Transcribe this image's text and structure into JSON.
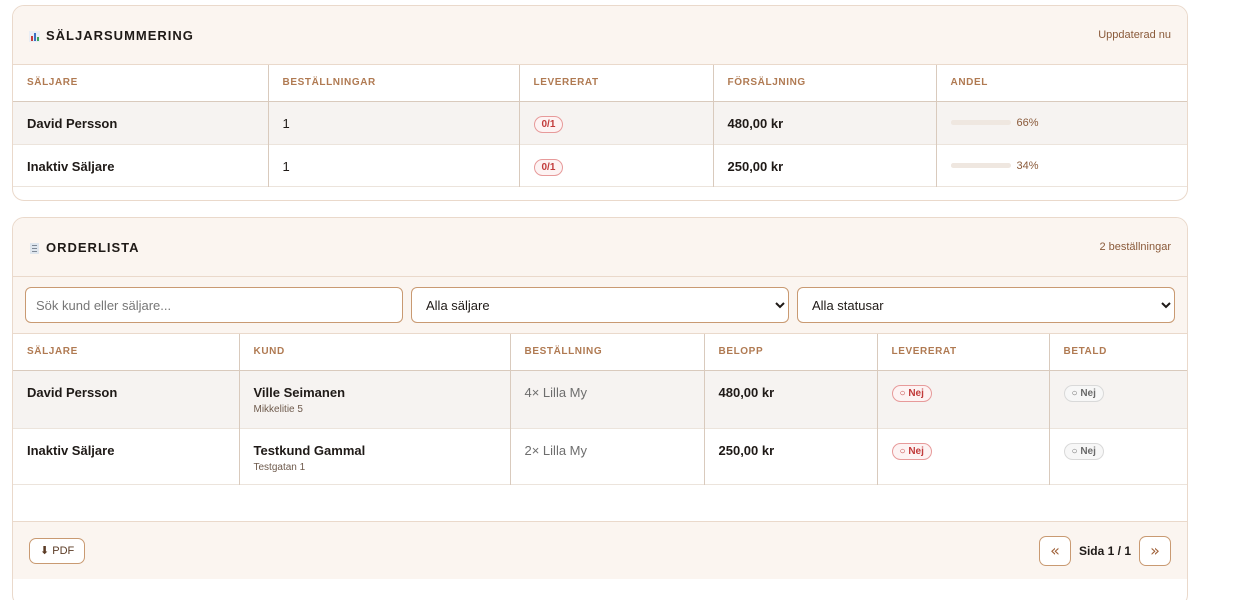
{
  "summary": {
    "title": "SÄLJARSUMMERING",
    "updated": "Uppdaterad nu",
    "columns": [
      "SÄLJARE",
      "BESTÄLLNINGAR",
      "LEVERERAT",
      "FÖRSÄLJNING",
      "ANDEL"
    ],
    "rows": [
      {
        "seller": "David Persson",
        "orders": "1",
        "delivered": "0/1",
        "sales": "480,00 kr",
        "share": "66%",
        "share_value": 66
      },
      {
        "seller": "Inaktiv Säljare",
        "orders": "1",
        "delivered": "0/1",
        "sales": "250,00 kr",
        "share": "34%",
        "share_value": 34
      }
    ]
  },
  "orders": {
    "title": "ORDERLISTA",
    "count": "2 beställningar",
    "search_placeholder": "Sök kund eller säljare...",
    "seller_filter": "Alla säljare",
    "status_filter": "Alla statusar",
    "columns": [
      "SÄLJARE",
      "KUND",
      "BESTÄLLNING",
      "BELOPP",
      "LEVERERAT",
      "BETALD"
    ],
    "rows": [
      {
        "seller": "David Persson",
        "customer": "Ville Seimanen",
        "address": "Mikkelitie 5",
        "order": "4× Lilla My",
        "amount": "480,00 kr",
        "delivered": "○ Nej",
        "paid": "○ Nej"
      },
      {
        "seller": "Inaktiv Säljare",
        "customer": "Testkund Gammal",
        "address": "Testgatan 1",
        "order": "2× Lilla My",
        "amount": "250,00 kr",
        "delivered": "○ Nej",
        "paid": "○ Nej"
      }
    ],
    "pdf_label": "⬇ PDF",
    "page_label": "Sida 1 / 1",
    "prev_label": "«",
    "next_label": "»"
  },
  "colors": {
    "accent": "#c99a72",
    "header_bg": "#fbf5f0",
    "column_header": "#b07a52",
    "badge_red": "#c23b3b"
  }
}
